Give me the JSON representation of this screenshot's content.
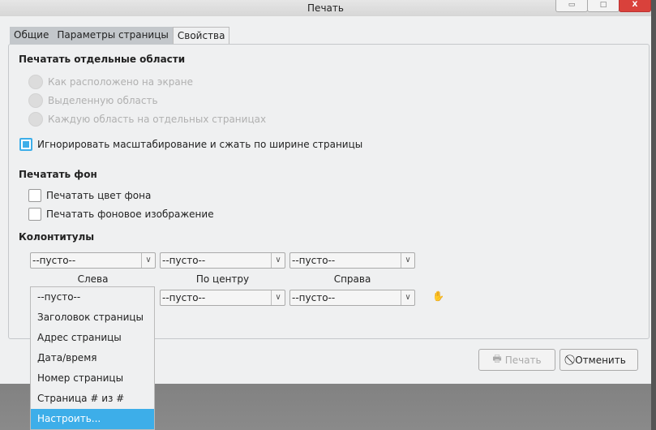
{
  "window": {
    "title": "Печать",
    "minimize": "▭",
    "maximize": "□",
    "close": "X"
  },
  "tabs": [
    {
      "label": "Общие"
    },
    {
      "label": "Параметры страницы"
    },
    {
      "label": "Свойства",
      "active": true
    }
  ],
  "sections": {
    "areas": {
      "title": "Печатать отдельные области",
      "options": [
        "Как расположено на экране",
        "Выделенную область",
        "Каждую область на отдельных страницах"
      ]
    },
    "fit": {
      "label": "Игнорировать масштабирование и сжать по ширине страницы",
      "checked": true
    },
    "background": {
      "title": "Печатать фон",
      "options": [
        {
          "label": "Печатать цвет фона",
          "checked": false
        },
        {
          "label": "Печатать фоновое изображение",
          "checked": false
        }
      ]
    },
    "headers": {
      "title": "Колонтитулы",
      "top": [
        "--пусто--",
        "--пусто--",
        "--пусто--"
      ],
      "labels": [
        "Слева",
        "По центру",
        "Справа"
      ],
      "bottom": [
        "--пусто--",
        "--пусто--",
        "--пусто--"
      ]
    }
  },
  "dropdown": {
    "options": [
      "--пусто--",
      "Заголовок страницы",
      "Адрес страницы",
      "Дата/время",
      "Номер страницы",
      "Страница # из #",
      "Настроить..."
    ],
    "highlighted": "Настроить..."
  },
  "buttons": {
    "print": "Печать",
    "cancel": "Отменить"
  },
  "colors": {
    "accent": "#3daee9"
  }
}
